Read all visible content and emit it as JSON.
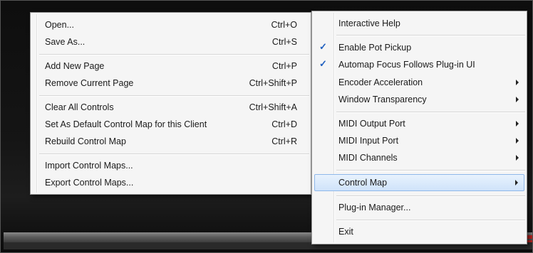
{
  "left_menu": {
    "items": [
      {
        "label": "Open...",
        "shortcut": "Ctrl+O"
      },
      {
        "label": "Save As...",
        "shortcut": "Ctrl+S"
      },
      {
        "label": "Add New Page",
        "shortcut": "Ctrl+P"
      },
      {
        "label": "Remove Current Page",
        "shortcut": "Ctrl+Shift+P"
      },
      {
        "label": "Clear All Controls",
        "shortcut": "Ctrl+Shift+A"
      },
      {
        "label": "Set As Default Control Map for this Client",
        "shortcut": "Ctrl+D"
      },
      {
        "label": "Rebuild Control Map",
        "shortcut": "Ctrl+R"
      },
      {
        "label": "Import Control Maps...",
        "shortcut": ""
      },
      {
        "label": "Export Control Maps...",
        "shortcut": ""
      }
    ]
  },
  "right_menu": {
    "check_glyph": "✓",
    "items": [
      {
        "label": "Interactive Help",
        "checked": false,
        "submenu": false
      },
      {
        "label": "Enable Pot Pickup",
        "checked": true,
        "submenu": false
      },
      {
        "label": "Automap Focus Follows Plug-in UI",
        "checked": true,
        "submenu": false
      },
      {
        "label": "Encoder Acceleration",
        "checked": false,
        "submenu": true
      },
      {
        "label": "Window Transparency",
        "checked": false,
        "submenu": true
      },
      {
        "label": "MIDI Output Port",
        "checked": false,
        "submenu": true
      },
      {
        "label": "MIDI Input Port",
        "checked": false,
        "submenu": true
      },
      {
        "label": "MIDI Channels",
        "checked": false,
        "submenu": true
      },
      {
        "label": "Control Map",
        "checked": false,
        "submenu": true,
        "highlighted": true
      },
      {
        "label": "Plug-in Manager...",
        "checked": false,
        "submenu": false
      },
      {
        "label": "Exit",
        "checked": false,
        "submenu": false
      }
    ]
  },
  "colors": {
    "menu_bg": "#f5f5f5",
    "highlight": "#cfe3fa",
    "check": "#1f5fbf",
    "accent_red": "#b8231f"
  }
}
